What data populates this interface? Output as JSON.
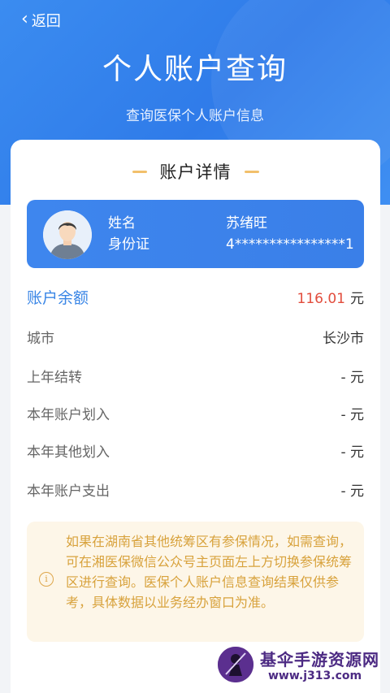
{
  "header": {
    "back_label": "返回",
    "title": "个人账户查询",
    "subtitle": "查询医保个人账户信息"
  },
  "section_title": "账户详情",
  "profile": {
    "name_label": "姓名",
    "name_value": "苏绪旺",
    "id_label": "身份证",
    "id_value": "4****************1"
  },
  "balance": {
    "label": "账户余额",
    "amount": "116.01",
    "unit": "元"
  },
  "rows": [
    {
      "label": "城市",
      "value": "长沙市"
    },
    {
      "label": "上年结转",
      "value": "- 元"
    },
    {
      "label": "本年账户划入",
      "value": "- 元"
    },
    {
      "label": "本年其他划入",
      "value": "- 元"
    },
    {
      "label": "本年账户支出",
      "value": "- 元"
    }
  ],
  "notice": {
    "icon": "info-icon",
    "text": "如果在湖南省其他统筹区有参保情况，如需查询，可在湘医保微信公众号主页面左上方切换参保统筹区进行查询。医保个人账户信息查询结果仅供参考，具体数据以业务经办窗口为准。"
  },
  "watermark": {
    "line1": "基伞手游资源网",
    "line2": "www.j313.com"
  },
  "colors": {
    "header_blue": "#3282ec",
    "accent_blue": "#3a86e6",
    "amount_red": "#e24d3d",
    "notice_bg": "#fdf6e8",
    "notice_text": "#d8a23c"
  }
}
